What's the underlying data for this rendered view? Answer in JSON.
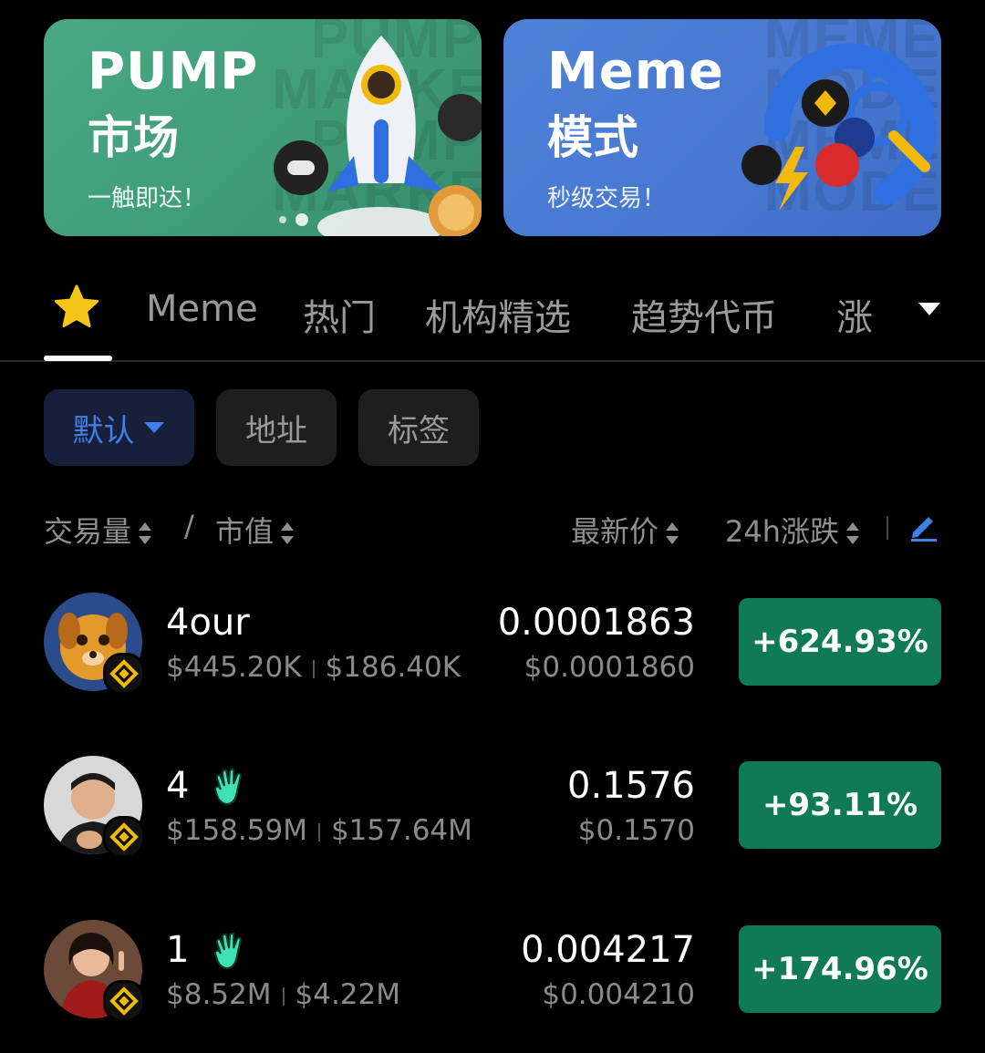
{
  "banners": [
    {
      "title": "PUMP",
      "title2": "市场",
      "subtitle": "一触即达！",
      "bg_word": "PUMP\nMARKET\nPUMP\nMARKET",
      "color": "#45a47f"
    },
    {
      "title": "Meme",
      "title2": "模式",
      "subtitle": "秒级交易！",
      "bg_word": "MEME\nMODE\nMEME\nMODE",
      "color": "#4b7dd5"
    }
  ],
  "tabs": {
    "favorite_icon": "star-icon",
    "items": [
      "Meme",
      "热门",
      "机构精选",
      "趋势代币",
      "涨"
    ],
    "more_icon": "caret-down-icon"
  },
  "filters": {
    "default": "默认",
    "address": "地址",
    "tag": "标签",
    "active_color": "#3f7fe6"
  },
  "columns": {
    "volume": "交易量",
    "divider": "/",
    "mcap": "市值",
    "price": "最新价",
    "change": "24h涨跌",
    "edit_icon": "pencil-icon"
  },
  "tokens": [
    {
      "name": "4our",
      "volume": "$445.20K",
      "mcap": "$186.40K",
      "price": "0.0001863",
      "usd": "$0.0001860",
      "change": "+624.93%",
      "badge": false
    },
    {
      "name": "4",
      "volume": "$158.59M",
      "mcap": "$157.64M",
      "price": "0.1576",
      "usd": "$0.1570",
      "change": "+93.11%",
      "badge": true
    },
    {
      "name": "1",
      "volume": "$8.52M",
      "mcap": "$4.22M",
      "price": "0.004217",
      "usd": "$0.004210",
      "change": "+174.96%",
      "badge": true
    }
  ],
  "colors": {
    "positive": "#0f7a55",
    "chain": "#f0b90b"
  }
}
